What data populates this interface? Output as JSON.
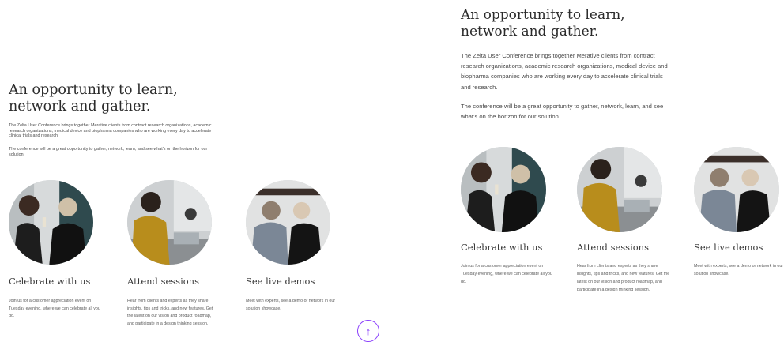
{
  "section": {
    "title_left": "An opportunity to learn, network and gather.",
    "title_right": "An opportunity to learn, network and gather.",
    "paragraph1": "The Zelta User Conference brings together Merative clients from contract research organizations, academic research organizations, medical device and biopharma companies who are working every day to accelerate clinical trials and research.",
    "paragraph2": "The conference will be a great opportunity to gather, network, learn, and see what's on the horizon for our solution."
  },
  "cards": [
    {
      "title": "Celebrate with us",
      "text": "Join us for a customer appreciation event on Tuesday evening, where we can celebrate all you do.",
      "image_icon": "celebration-photo"
    },
    {
      "title": "Attend sessions",
      "text": "Hear from clients and experts as they share insights, tips and tricks, and new features. Get the latest on our vision and product roadmap, and participate in a design thinking session.",
      "image_icon": "sessions-photo"
    },
    {
      "title": "See live demos",
      "text": "Meet with experts, see a demo or network in our solution showcase.",
      "image_icon": "demos-photo"
    }
  ],
  "back_to_top": {
    "icon": "arrow-up-icon",
    "glyph": "↑"
  },
  "colors": {
    "accent": "#8a3ffc",
    "text_dark": "#2b2b2b",
    "text_body": "#4a4a4a"
  }
}
